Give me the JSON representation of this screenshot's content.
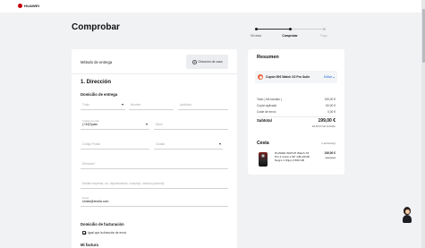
{
  "header": {
    "brand": "HUAWEI"
  },
  "page": {
    "title": "Comprobar"
  },
  "steps": [
    {
      "label": "Mi cesta",
      "state": "done"
    },
    {
      "label": "Comprobar",
      "state": "active"
    },
    {
      "label": "Pago",
      "state": "pending"
    }
  ],
  "delivery": {
    "label": "Método de entrega",
    "option": "Dirección de casa"
  },
  "address": {
    "section_title": "1. Dirección",
    "shipping_title": "Domicilio de entrega",
    "fields": {
      "title": {
        "placeholder": "Título"
      },
      "first_name": {
        "placeholder": "Nombre"
      },
      "last_name": {
        "placeholder": "Apellidos"
      },
      "country_code": {
        "label": "Código de país",
        "value": "(+34)Spain"
      },
      "phone": {
        "placeholder": "Móvil"
      },
      "postal_code": {
        "placeholder": "Código Postal"
      },
      "city": {
        "placeholder": "Ciudad"
      },
      "address": {
        "placeholder": "Dirección*"
      },
      "address2": {
        "placeholder": "Detalle empresa, c/o, departamento, complejo, unidad (opcional)"
      },
      "email": {
        "label": "Email",
        "value": "sholla@sholla.com"
      }
    },
    "billing_title": "Domicilio de facturación",
    "same_as_shipping": "Igual que la dirección de envío",
    "next_section": "Mi factura"
  },
  "summary": {
    "title": "Resumen",
    "coupon": {
      "code": "Cupón 50€ Watch X3 Pro Suite",
      "edit_label": "Editar"
    },
    "lines": [
      {
        "label": "Total ( IVA incluido )",
        "value": "249,00 €"
      },
      {
        "label": "Cupón aplicado",
        "value": "-50,00 €"
      },
      {
        "label": "Coste de envío",
        "value": "0,00 €"
      }
    ],
    "subtotal": {
      "label": "Subtotal",
      "value": "199,00 €",
      "note": "34,54 € IVA incluido"
    }
  },
  "cart": {
    "title": "Cesta",
    "count": "1 artículo(s)",
    "items": [
      {
        "name": "HUAWEI WATCH Watch X3 Pro 2 única 1.52\" GB+16GB Negro 1 (Fijo) 2 800 GB",
        "price": "249,00 €",
        "old_price": "300,00 €"
      }
    ]
  }
}
